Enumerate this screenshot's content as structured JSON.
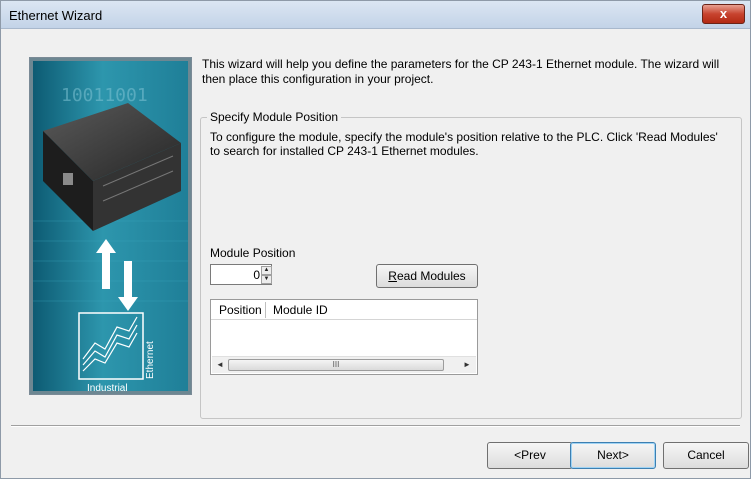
{
  "window": {
    "title": "Ethernet Wizard",
    "close_label": "x"
  },
  "illustration": {
    "binary_digits": "10011001",
    "product_word": "Industrial",
    "network_word": "Ethernet"
  },
  "intro_text": "This wizard will help you define the parameters for the CP 243-1 Ethernet module. The wizard will then place this configuration in your project.",
  "group": {
    "legend": "Specify Module Position",
    "description": "To configure the module, specify the module's position relative to the PLC. Click 'Read Modules' to search for installed CP 243-1 Ethernet modules."
  },
  "module_position": {
    "label": "Module Position",
    "value": "0"
  },
  "read_modules": {
    "label_mnemonic": "R",
    "label_rest": "ead Modules"
  },
  "listview": {
    "columns": [
      "Position",
      "Module ID"
    ],
    "scroll_thumb": "III"
  },
  "buttons": {
    "prev": "<Prev",
    "next": "Next>",
    "cancel": "Cancel"
  }
}
